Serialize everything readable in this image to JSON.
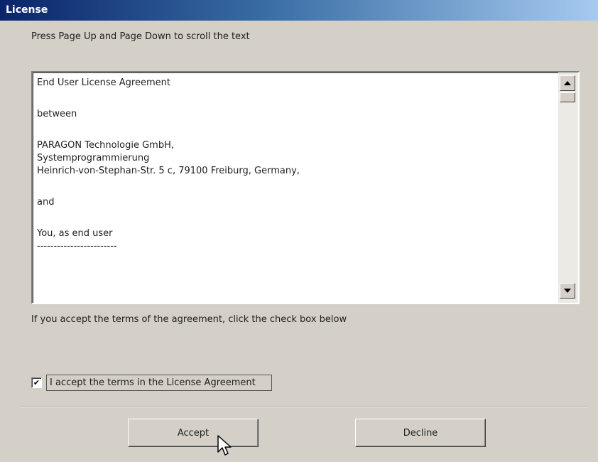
{
  "window": {
    "title": "License"
  },
  "instructions": {
    "scroll_hint": "Press Page Up and Page Down to scroll the text"
  },
  "license_text": {
    "lines": [
      "End User License Agreement",
      "between",
      "PARAGON Technologie GmbH,",
      "Systemprogrammierung",
      "Heinrich-von-Stephan-Str. 5 c, 79100 Freiburg, Germany,",
      "and",
      "You, as end user",
      "------------------------"
    ]
  },
  "prompt": {
    "accept_instruction": "If you accept the terms of the agreement, click the check box below"
  },
  "checkbox": {
    "label": "I accept the terms in the License Agreement",
    "checked": true,
    "mark": "✔"
  },
  "buttons": {
    "accept_label": "Accept",
    "decline_label": "Decline"
  },
  "icons": {
    "scroll_up": "scroll-up-arrow-icon",
    "scroll_down": "scroll-down-arrow-icon",
    "cursor": "mouse-pointer-icon"
  },
  "colors": {
    "title_bar_start": "#0a246a",
    "title_bar_end": "#a6caf0",
    "dialog_bg": "#d4d0c8"
  }
}
